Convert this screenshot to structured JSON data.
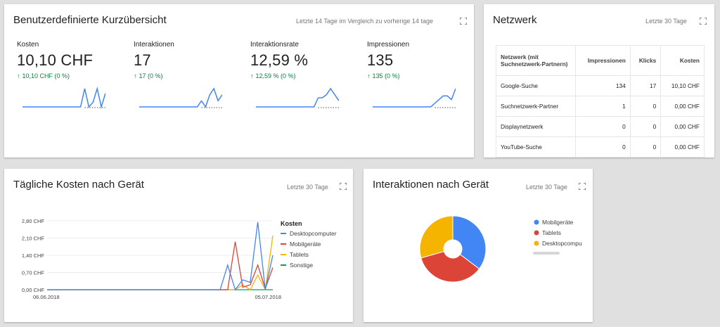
{
  "summary": {
    "title": "Benutzerdefinierte Kurzübersicht",
    "period": "Letzte 14 Tage im Vergleich zu vorherige 14 tage",
    "metrics": [
      {
        "label": "Kosten",
        "value": "10,10 CHF",
        "change": "10,10 CHF (0 %)",
        "trend": [
          0,
          0,
          0,
          0,
          0,
          0,
          0,
          0,
          0,
          0,
          0,
          0,
          0,
          0,
          0,
          4,
          0,
          1,
          4,
          0,
          3
        ]
      },
      {
        "label": "Interaktionen",
        "value": "17",
        "change": "17 (0 %)",
        "trend": [
          0,
          0,
          0,
          0,
          0,
          0,
          0,
          0,
          0,
          0,
          0,
          0,
          0,
          0,
          0,
          1,
          0,
          2,
          3,
          1,
          2
        ]
      },
      {
        "label": "Interaktionsrate",
        "value": "12,59 %",
        "change": "12,59 % (0 %)",
        "trend": [
          0,
          0,
          0,
          0,
          0,
          0,
          0,
          0,
          0,
          0,
          0,
          0,
          0,
          0,
          0,
          1.5,
          1.5,
          2,
          3,
          2,
          1
        ]
      },
      {
        "label": "Impressionen",
        "value": "135",
        "change": "135 (0 %)",
        "trend": [
          0,
          0,
          0,
          0,
          0,
          0,
          0,
          0,
          0,
          0,
          0,
          0,
          0,
          0,
          0,
          1,
          2,
          3,
          3,
          2,
          5
        ]
      }
    ]
  },
  "network": {
    "title": "Netzwerk",
    "period": "Letzte 30 Tage",
    "columns": [
      "Netzwerk (mit Suchnetzwerk-Partnern)",
      "Impressionen",
      "Klicks",
      "Kosten"
    ],
    "rows": [
      [
        "Google-Suche",
        "134",
        "17",
        "10,10 CHF"
      ],
      [
        "Suchnetzwerk-Partner",
        "1",
        "0",
        "0,00 CHF"
      ],
      [
        "Displaynetzwerk",
        "0",
        "0",
        "0,00 CHF"
      ],
      [
        "YouTube-Suche",
        "0",
        "0",
        "0,00 CHF"
      ]
    ]
  },
  "daily": {
    "title": "Tägliche Kosten nach Gerät",
    "period": "Letzte 30 Tage"
  },
  "interactions": {
    "title": "Interaktionen nach Gerät",
    "period": "Letzte 30 Tage"
  },
  "colors": {
    "blue": "#4285f4",
    "red": "#db4437",
    "yellow": "#f4b400",
    "green": "#0f9d58",
    "positive": "#0b8043"
  },
  "chart_data": [
    {
      "type": "line",
      "x_start": "06.06.2018",
      "x_end": "05.07.2018",
      "x_tick_labels": [
        "06.06.2018",
        "05.07.2018"
      ],
      "y_ticks": [
        "0,00 CHF",
        "0,70 CHF",
        "1,40 CHF",
        "2,10 CHF",
        "2,80 CHF"
      ],
      "ylim": [
        0,
        2.8
      ],
      "legend_title": "Kosten",
      "legend_position": "right",
      "grid": true,
      "series": [
        {
          "name": "Desktopcomputer",
          "color": "#4285f4",
          "values": [
            0,
            0,
            0,
            0,
            0,
            0,
            0,
            0,
            0,
            0,
            0,
            0,
            0,
            0,
            0,
            0,
            0,
            0,
            0,
            0,
            0,
            0,
            0,
            0,
            1.0,
            0,
            0.4,
            0.3,
            2.75,
            0,
            1.4
          ]
        },
        {
          "name": "Mobilgeräte",
          "color": "#db4437",
          "values": [
            0,
            0,
            0,
            0,
            0,
            0,
            0,
            0,
            0,
            0,
            0,
            0,
            0,
            0,
            0,
            0,
            0,
            0,
            0,
            0,
            0,
            0,
            0,
            0,
            0,
            1.95,
            0.1,
            0.2,
            1.0,
            0.05,
            0.9
          ]
        },
        {
          "name": "Tablets",
          "color": "#f4b400",
          "values": [
            0,
            0,
            0,
            0,
            0,
            0,
            0,
            0,
            0,
            0,
            0,
            0,
            0,
            0,
            0,
            0,
            0,
            0,
            0,
            0,
            0,
            0,
            0,
            0,
            0,
            0,
            0.2,
            0,
            0.6,
            0,
            2.2
          ]
        },
        {
          "name": "Sonstige",
          "color": "#0f9d58",
          "values": [
            0,
            0,
            0,
            0,
            0,
            0,
            0,
            0,
            0,
            0,
            0,
            0,
            0,
            0,
            0,
            0,
            0,
            0,
            0,
            0,
            0,
            0,
            0,
            0,
            0,
            0,
            0,
            0,
            0,
            0,
            0
          ]
        }
      ]
    },
    {
      "type": "pie",
      "donut": true,
      "legend_position": "right",
      "slices": [
        {
          "name": "Mobilgeräte",
          "value": 6,
          "color": "#4285f4"
        },
        {
          "name": "Tablets",
          "value": 6,
          "color": "#db4437"
        },
        {
          "name": "Desktopcompu",
          "value": 5,
          "color": "#f4b400"
        }
      ]
    }
  ]
}
